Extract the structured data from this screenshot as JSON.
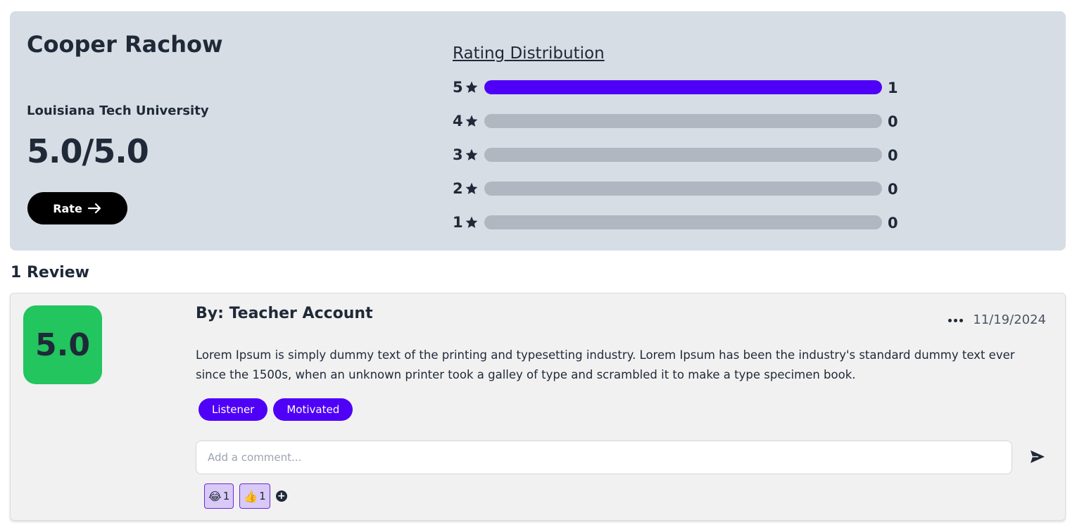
{
  "professor": {
    "name": "Cooper Rachow",
    "university": "Louisiana Tech University",
    "rating_display": "5.0/5.0",
    "rate_button_label": "Rate",
    "rate_button_icon": "arrow-right-icon"
  },
  "distribution": {
    "title": "Rating Distribution",
    "star_icon": "star-icon",
    "bar_color": "#4f00f7",
    "track_color": "#b0b7c0",
    "rows": [
      {
        "stars": "5",
        "count": "1",
        "fraction": 1.0
      },
      {
        "stars": "4",
        "count": "0",
        "fraction": 0
      },
      {
        "stars": "3",
        "count": "0",
        "fraction": 0
      },
      {
        "stars": "2",
        "count": "0",
        "fraction": 0
      },
      {
        "stars": "1",
        "count": "0",
        "fraction": 0
      }
    ]
  },
  "reviews": {
    "heading": "1 Review",
    "items": [
      {
        "score": "5.0",
        "score_color": "#22c55e",
        "author": "By: Teacher Account",
        "date": "11/19/2024",
        "menu_icon": "more-horizontal-icon",
        "text": "Lorem Ipsum is simply dummy text of the printing and typesetting industry. Lorem Ipsum has been the industry's standard dummy text ever since the 1500s, when an unknown printer took a galley of type and scrambled it to make a type specimen book.",
        "tags": [
          "Listener",
          "Motivated"
        ],
        "comment_placeholder": "Add a comment...",
        "comment_value": "",
        "send_icon": "send-icon",
        "reactions": [
          {
            "emoji": "😂",
            "name": "laughing-emoji",
            "count": "1"
          },
          {
            "emoji": "👍",
            "name": "thumbs-up-emoji",
            "count": "1"
          }
        ],
        "add_reaction_icon": "plus-circle-icon"
      }
    ]
  }
}
